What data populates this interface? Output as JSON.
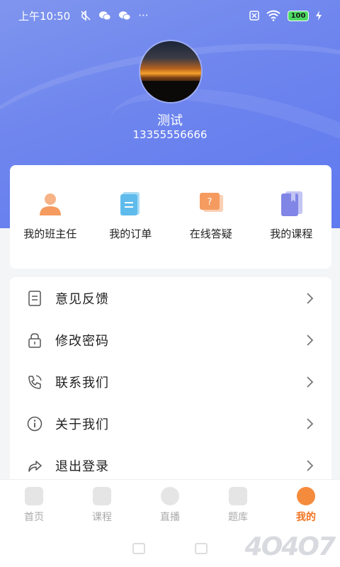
{
  "status_bar": {
    "time": "上午10:50",
    "battery": "100",
    "more": "···"
  },
  "profile": {
    "name": "测试",
    "phone": "13355556666"
  },
  "quick_links": [
    {
      "label": "我的班主任",
      "icon": "teacher-icon",
      "color": "#f6a26b"
    },
    {
      "label": "我的订单",
      "icon": "order-icon",
      "color": "#6dc3ee"
    },
    {
      "label": "在线答疑",
      "icon": "question-icon",
      "color": "#f6a26b"
    },
    {
      "label": "我的课程",
      "icon": "course-icon",
      "color": "#8b8fe8"
    }
  ],
  "menu": [
    {
      "label": "意见反馈",
      "icon": "feedback-icon"
    },
    {
      "label": "修改密码",
      "icon": "lock-icon"
    },
    {
      "label": "联系我们",
      "icon": "phone-icon"
    },
    {
      "label": "关于我们",
      "icon": "info-icon"
    },
    {
      "label": "退出登录",
      "icon": "logout-icon"
    }
  ],
  "tabs": [
    {
      "label": "首页",
      "icon": "home-icon",
      "active": false
    },
    {
      "label": "课程",
      "icon": "course-tab-icon",
      "active": false
    },
    {
      "label": "直播",
      "icon": "live-icon",
      "active": false
    },
    {
      "label": "题库",
      "icon": "question-bank-icon",
      "active": false
    },
    {
      "label": "我的",
      "icon": "profile-icon",
      "active": true
    }
  ],
  "watermark": "4O4O7",
  "colors": {
    "header": "#6f86ee",
    "accent": "#f0731f"
  }
}
